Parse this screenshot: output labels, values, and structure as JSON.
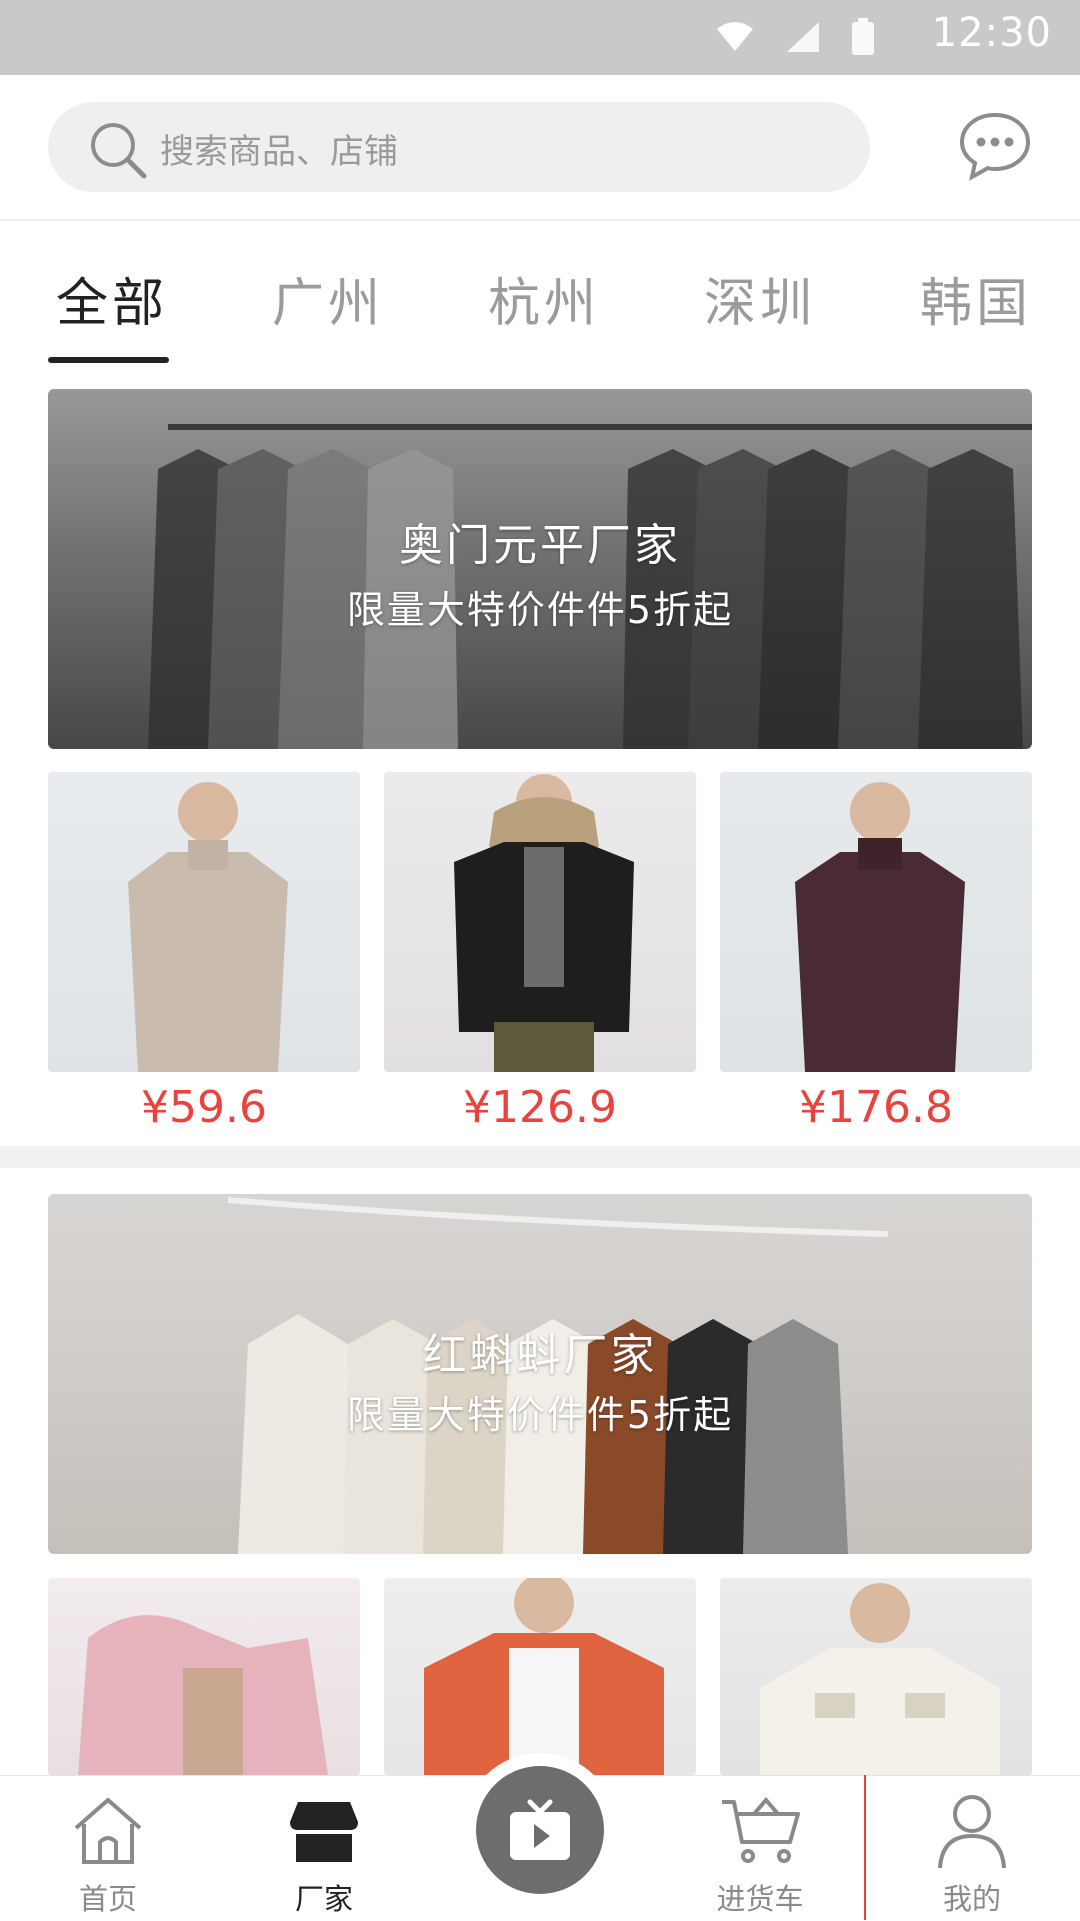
{
  "status_bar": {
    "time": "12:30"
  },
  "search": {
    "placeholder": "搜索商品、店铺"
  },
  "tabs": [
    {
      "label": "全部",
      "active": true
    },
    {
      "label": "广州",
      "active": false
    },
    {
      "label": "杭州",
      "active": false
    },
    {
      "label": "深圳",
      "active": false
    },
    {
      "label": "韩国",
      "active": false
    }
  ],
  "sections": [
    {
      "title": "奥门元平厂家",
      "subtitle": "限量大特价件件5折起",
      "products": [
        {
          "price": "¥59.6"
        },
        {
          "price": "¥126.9"
        },
        {
          "price": "¥176.8"
        }
      ]
    },
    {
      "title": "红蝌蚪厂家",
      "subtitle": "限量大特价件件5折起",
      "products": [
        {},
        {},
        {}
      ]
    }
  ],
  "bottom_nav": [
    {
      "label": "首页",
      "icon": "home-icon",
      "active": false
    },
    {
      "label": "厂家",
      "icon": "store-icon",
      "active": true
    },
    {
      "label": "",
      "icon": "play-tv-icon",
      "active": false
    },
    {
      "label": "进货车",
      "icon": "cart-icon",
      "active": false
    },
    {
      "label": "我的",
      "icon": "person-icon",
      "active": false
    }
  ],
  "colors": {
    "accent": "#e8433e",
    "statusbar": "#c9c9c9",
    "active_text": "#222222",
    "inactive_text": "#9b9b9b"
  }
}
